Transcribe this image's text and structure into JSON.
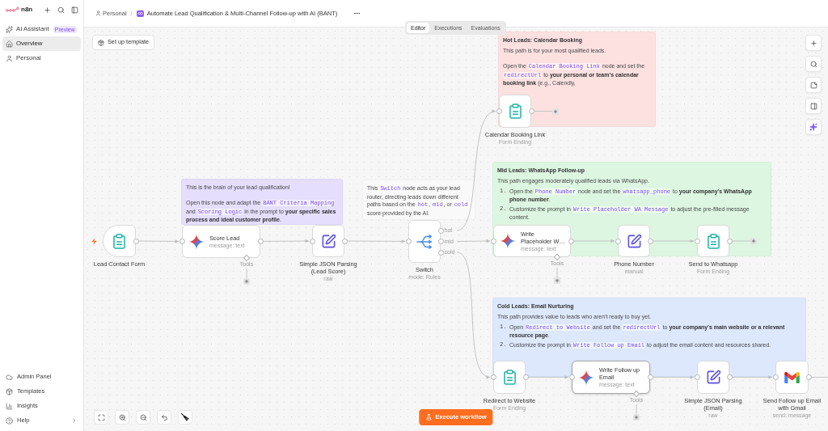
{
  "sidebar": {
    "brand": "n8n",
    "items": [
      {
        "label": "AI Assistant",
        "badge": "Preview",
        "selected": false
      },
      {
        "label": "Overview",
        "selected": true
      },
      {
        "label": "Personal",
        "selected": false
      }
    ],
    "bottom_items": [
      {
        "label": "Admin Panel",
        "submenu": false
      },
      {
        "label": "Templates",
        "submenu": false
      },
      {
        "label": "Insights",
        "submenu": false
      },
      {
        "label": "Help",
        "submenu": true
      }
    ]
  },
  "header": {
    "breadcrumb": "Personal",
    "separator": "/",
    "title": "Automate Lead Qualification & Multi-Channel Follow-up with AI (BANT)"
  },
  "view_tabs": [
    {
      "label": "Editor",
      "selected": true
    },
    {
      "label": "Executions",
      "selected": false
    },
    {
      "label": "Evaluations",
      "selected": false
    }
  ],
  "canvas": {
    "setup_button": "Set up template",
    "notes": [
      {
        "color": "#fde1e1",
        "title": "Hot Leads: Calendar Booking",
        "blocks": [
          {
            "kind": "para",
            "segments": [
              {
                "kind": "text",
                "text": "This path is for your most qualified leads."
              }
            ]
          },
          {
            "kind": "para",
            "segments": [
              {
                "kind": "text",
                "text": "Open the "
              },
              {
                "kind": "code",
                "text": "Calendar Booking Link"
              },
              {
                "kind": "text",
                "text": " node and set the "
              },
              {
                "kind": "code",
                "text": "redirectUrl"
              },
              {
                "kind": "text",
                "text": " to "
              },
              {
                "kind": "bold",
                "text": "your personal or team's calendar booking link"
              },
              {
                "kind": "text",
                "text": " (e.g., Calendly,"
              }
            ]
          }
        ]
      },
      {
        "color": "#e5defd",
        "blocks": [
          {
            "kind": "para",
            "segments": [
              {
                "kind": "text",
                "text": "This is the brain of your lead qualification!"
              }
            ]
          },
          {
            "kind": "para",
            "segments": [
              {
                "kind": "text",
                "text": "Open this node and adapt the "
              },
              {
                "kind": "code",
                "text": "BANT Criteria Mapping"
              },
              {
                "kind": "text",
                "text": " and "
              },
              {
                "kind": "code",
                "text": "Scoring Logic"
              },
              {
                "kind": "text",
                "text": " in the prompt to "
              },
              {
                "kind": "bold",
                "text": "your specific sales process and ideal customer profile"
              },
              {
                "kind": "text",
                "text": "."
              }
            ]
          }
        ]
      },
      {
        "color": "#f9f9f9",
        "blocks": [
          {
            "kind": "para",
            "segments": [
              {
                "kind": "text",
                "text": "This "
              },
              {
                "kind": "code",
                "text": "Switch"
              },
              {
                "kind": "text",
                "text": " node acts as your lead router, directing leads down different paths based on the "
              },
              {
                "kind": "code",
                "text": "hot"
              },
              {
                "kind": "text",
                "text": ", "
              },
              {
                "kind": "code",
                "text": "mid"
              },
              {
                "kind": "text",
                "text": ", or "
              },
              {
                "kind": "code",
                "text": "cold"
              },
              {
                "kind": "text",
                "text": " score provided by the AI."
              }
            ]
          }
        ]
      },
      {
        "color": "#ddf6e1",
        "title": "Mid Leads: WhatsApp Follow-up",
        "blocks": [
          {
            "kind": "para",
            "segments": [
              {
                "kind": "text",
                "text": "This path engages moderately qualified leads via WhatsApp."
              }
            ]
          },
          {
            "kind": "list_item",
            "marker": "1.",
            "segments": [
              {
                "kind": "text",
                "text": "Open the "
              },
              {
                "kind": "code",
                "text": "Phone Number"
              },
              {
                "kind": "text",
                "text": " node and set the "
              },
              {
                "kind": "code",
                "text": "whatsapp_phone"
              },
              {
                "kind": "text",
                "text": " to "
              },
              {
                "kind": "bold",
                "text": "your company's WhatsApp phone number"
              },
              {
                "kind": "text",
                "text": "."
              }
            ]
          },
          {
            "kind": "list_item",
            "marker": "2.",
            "segments": [
              {
                "kind": "text",
                "text": "Customize the prompt in "
              },
              {
                "kind": "code",
                "text": "Write Placeholder WA Message"
              },
              {
                "kind": "text",
                "text": " to adjust the pre-filled message content."
              }
            ]
          }
        ]
      },
      {
        "color": "#dde8fc",
        "title": "Cold Leads: Email Nurturing",
        "blocks": [
          {
            "kind": "para",
            "segments": [
              {
                "kind": "text",
                "text": "This path provides value to leads who aren't ready to buy yet."
              }
            ]
          },
          {
            "kind": "list_item",
            "marker": "1.",
            "segments": [
              {
                "kind": "text",
                "text": "Open "
              },
              {
                "kind": "code",
                "text": "Redirect to Website"
              },
              {
                "kind": "text",
                "text": " and set the "
              },
              {
                "kind": "code",
                "text": "redirectUrl"
              },
              {
                "kind": "text",
                "text": " to "
              },
              {
                "kind": "bold",
                "text": "your company's main website or a relevant resource page"
              },
              {
                "kind": "text",
                "text": "."
              }
            ]
          },
          {
            "kind": "list_item",
            "marker": "2.",
            "segments": [
              {
                "kind": "text",
                "text": "Customize the prompt in "
              },
              {
                "kind": "code",
                "text": "Write Follow up Email"
              },
              {
                "kind": "text",
                "text": " to adjust the email content and resources shared."
              }
            ]
          }
        ]
      }
    ],
    "nodes": [
      {
        "kind": "trigger",
        "name": "Lead Contact Form",
        "selected": false
      },
      {
        "kind": "agent",
        "name": "Score Lead",
        "subtitle": "message: text",
        "tools_label": "Tools",
        "selected": false
      },
      {
        "kind": "set",
        "name": "Simple JSON Parsing (Lead Score)",
        "subtitle": "raw",
        "selected": false
      },
      {
        "kind": "switch",
        "name": "Switch",
        "subtitle": "mode: Rules",
        "outputs": [
          "hot",
          "mid",
          "cold"
        ],
        "selected": false
      },
      {
        "kind": "form",
        "name": "Calendar Booking Link",
        "subtitle": "Form Ending",
        "selected": false
      },
      {
        "kind": "agent",
        "name": "Write Placeholder W…",
        "subtitle": "message: text",
        "tools_label": "Tools",
        "selected": false
      },
      {
        "kind": "set",
        "name": "Phone Number",
        "subtitle": "manual",
        "selected": false
      },
      {
        "kind": "form",
        "name": "Send to Whatsapp",
        "subtitle": "Form Ending",
        "selected": false
      },
      {
        "kind": "form",
        "name": "Redirect to Website",
        "subtitle": "Form Ending",
        "selected": false
      },
      {
        "kind": "agent",
        "name": "Write Follow up Email",
        "subtitle": "message: text",
        "tools_label": "Tools",
        "selected": true
      },
      {
        "kind": "set",
        "name": "Simple JSON Parsing (Email)",
        "subtitle": "raw",
        "selected": false
      },
      {
        "kind": "gmail",
        "name": "Send Follow up Email with Gmail",
        "subtitle": "send: message",
        "selected": false
      }
    ],
    "execute_button": "Execute workflow"
  }
}
